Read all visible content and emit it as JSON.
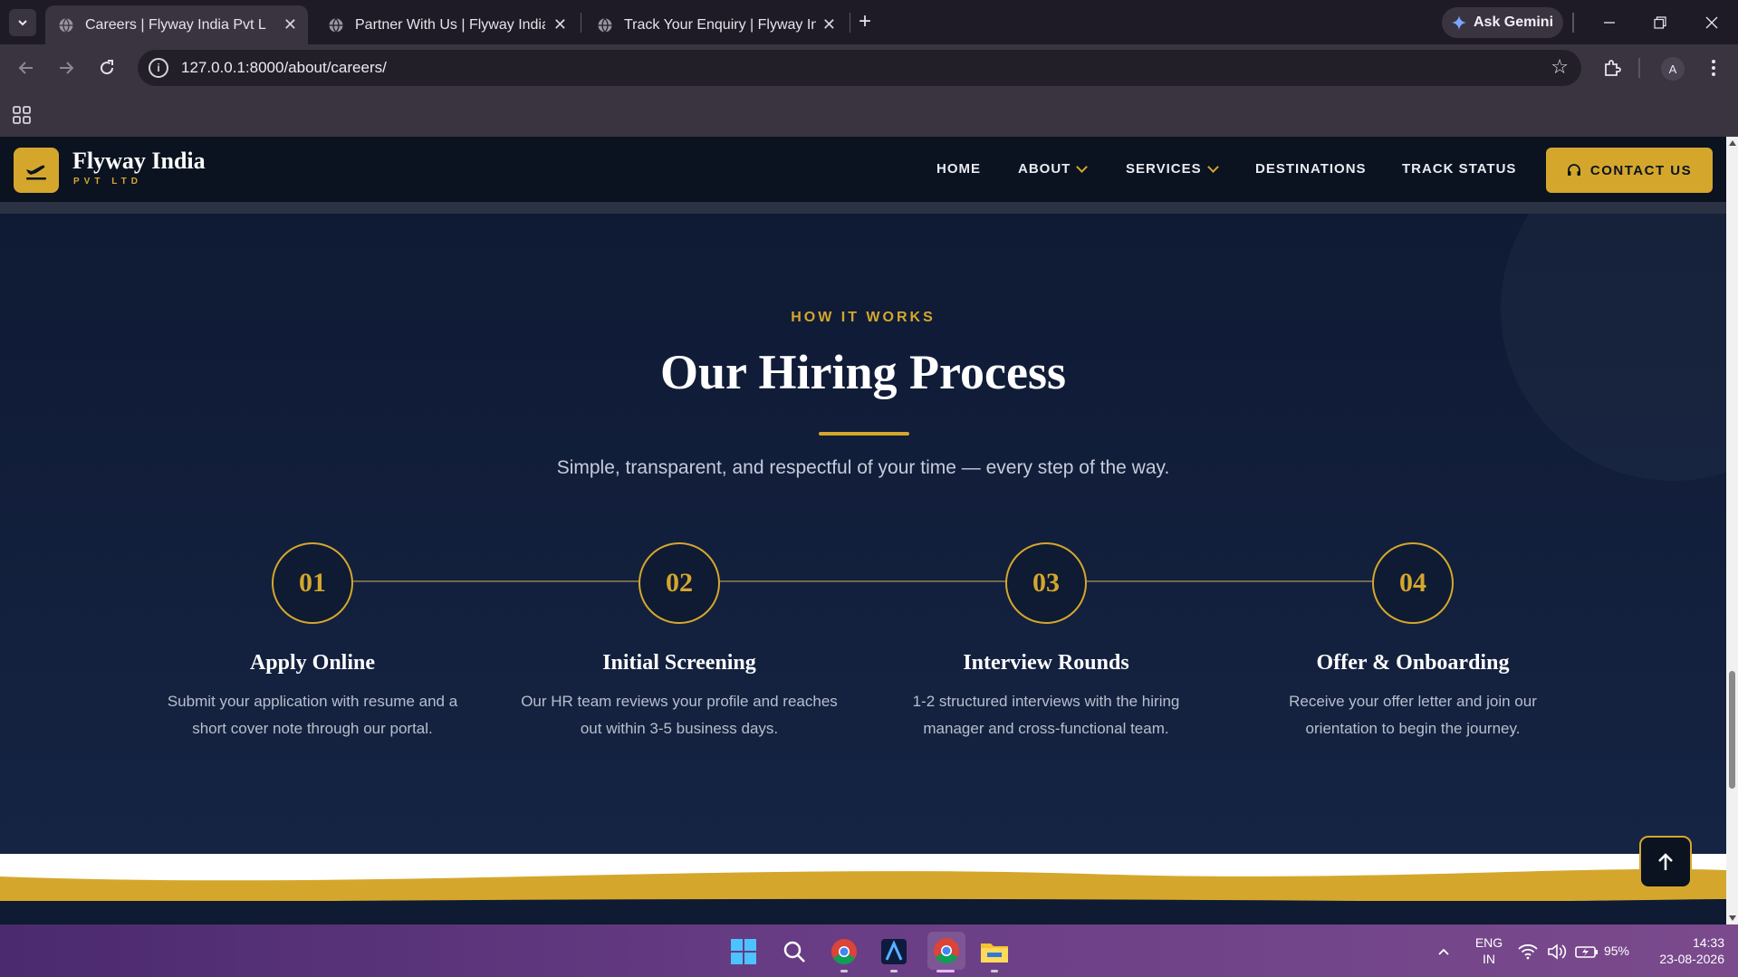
{
  "browser": {
    "tabs": [
      {
        "title": "Careers | Flyway India Pvt Ltd",
        "active": true
      },
      {
        "title": "Partner With Us | Flyway India",
        "active": false
      },
      {
        "title": "Track Your Enquiry | Flyway India",
        "active": false
      }
    ],
    "ask_gemini": "Ask Gemini",
    "url": "127.0.0.1:8000/about/careers/",
    "profile_initial": "A"
  },
  "site": {
    "brand": {
      "name": "Flyway India",
      "sub": "PVT LTD"
    },
    "nav": {
      "home": "HOME",
      "about": "ABOUT",
      "services": "SERVICES",
      "destinations": "DESTINATIONS",
      "track": "TRACK STATUS",
      "contact": "CONTACT US"
    },
    "section": {
      "eyebrow": "HOW IT WORKS",
      "heading": "Our Hiring Process",
      "lead": "Simple, transparent, and respectful of your time — every step of the way."
    },
    "steps": [
      {
        "num": "01",
        "title": "Apply Online",
        "desc1": "Submit your application with resume and a",
        "desc2": "short cover note through our portal."
      },
      {
        "num": "02",
        "title": "Initial Screening",
        "desc1": "Our HR team reviews your profile and reaches",
        "desc2": "out within 3-5 business days."
      },
      {
        "num": "03",
        "title": "Interview Rounds",
        "desc1": "1-2 structured interviews with the hiring",
        "desc2": "manager and cross-functional team."
      },
      {
        "num": "04",
        "title": "Offer & Onboarding",
        "desc1": "Receive your offer letter and join our",
        "desc2": "orientation to begin the journey."
      }
    ]
  },
  "taskbar": {
    "lang1": "ENG",
    "lang2": "IN",
    "battery": "95%",
    "time": "14:33",
    "date": "23-08-2026"
  },
  "colors": {
    "accent": "#d4a72c",
    "navy": "#0f1a33",
    "header": "#0b1220"
  }
}
